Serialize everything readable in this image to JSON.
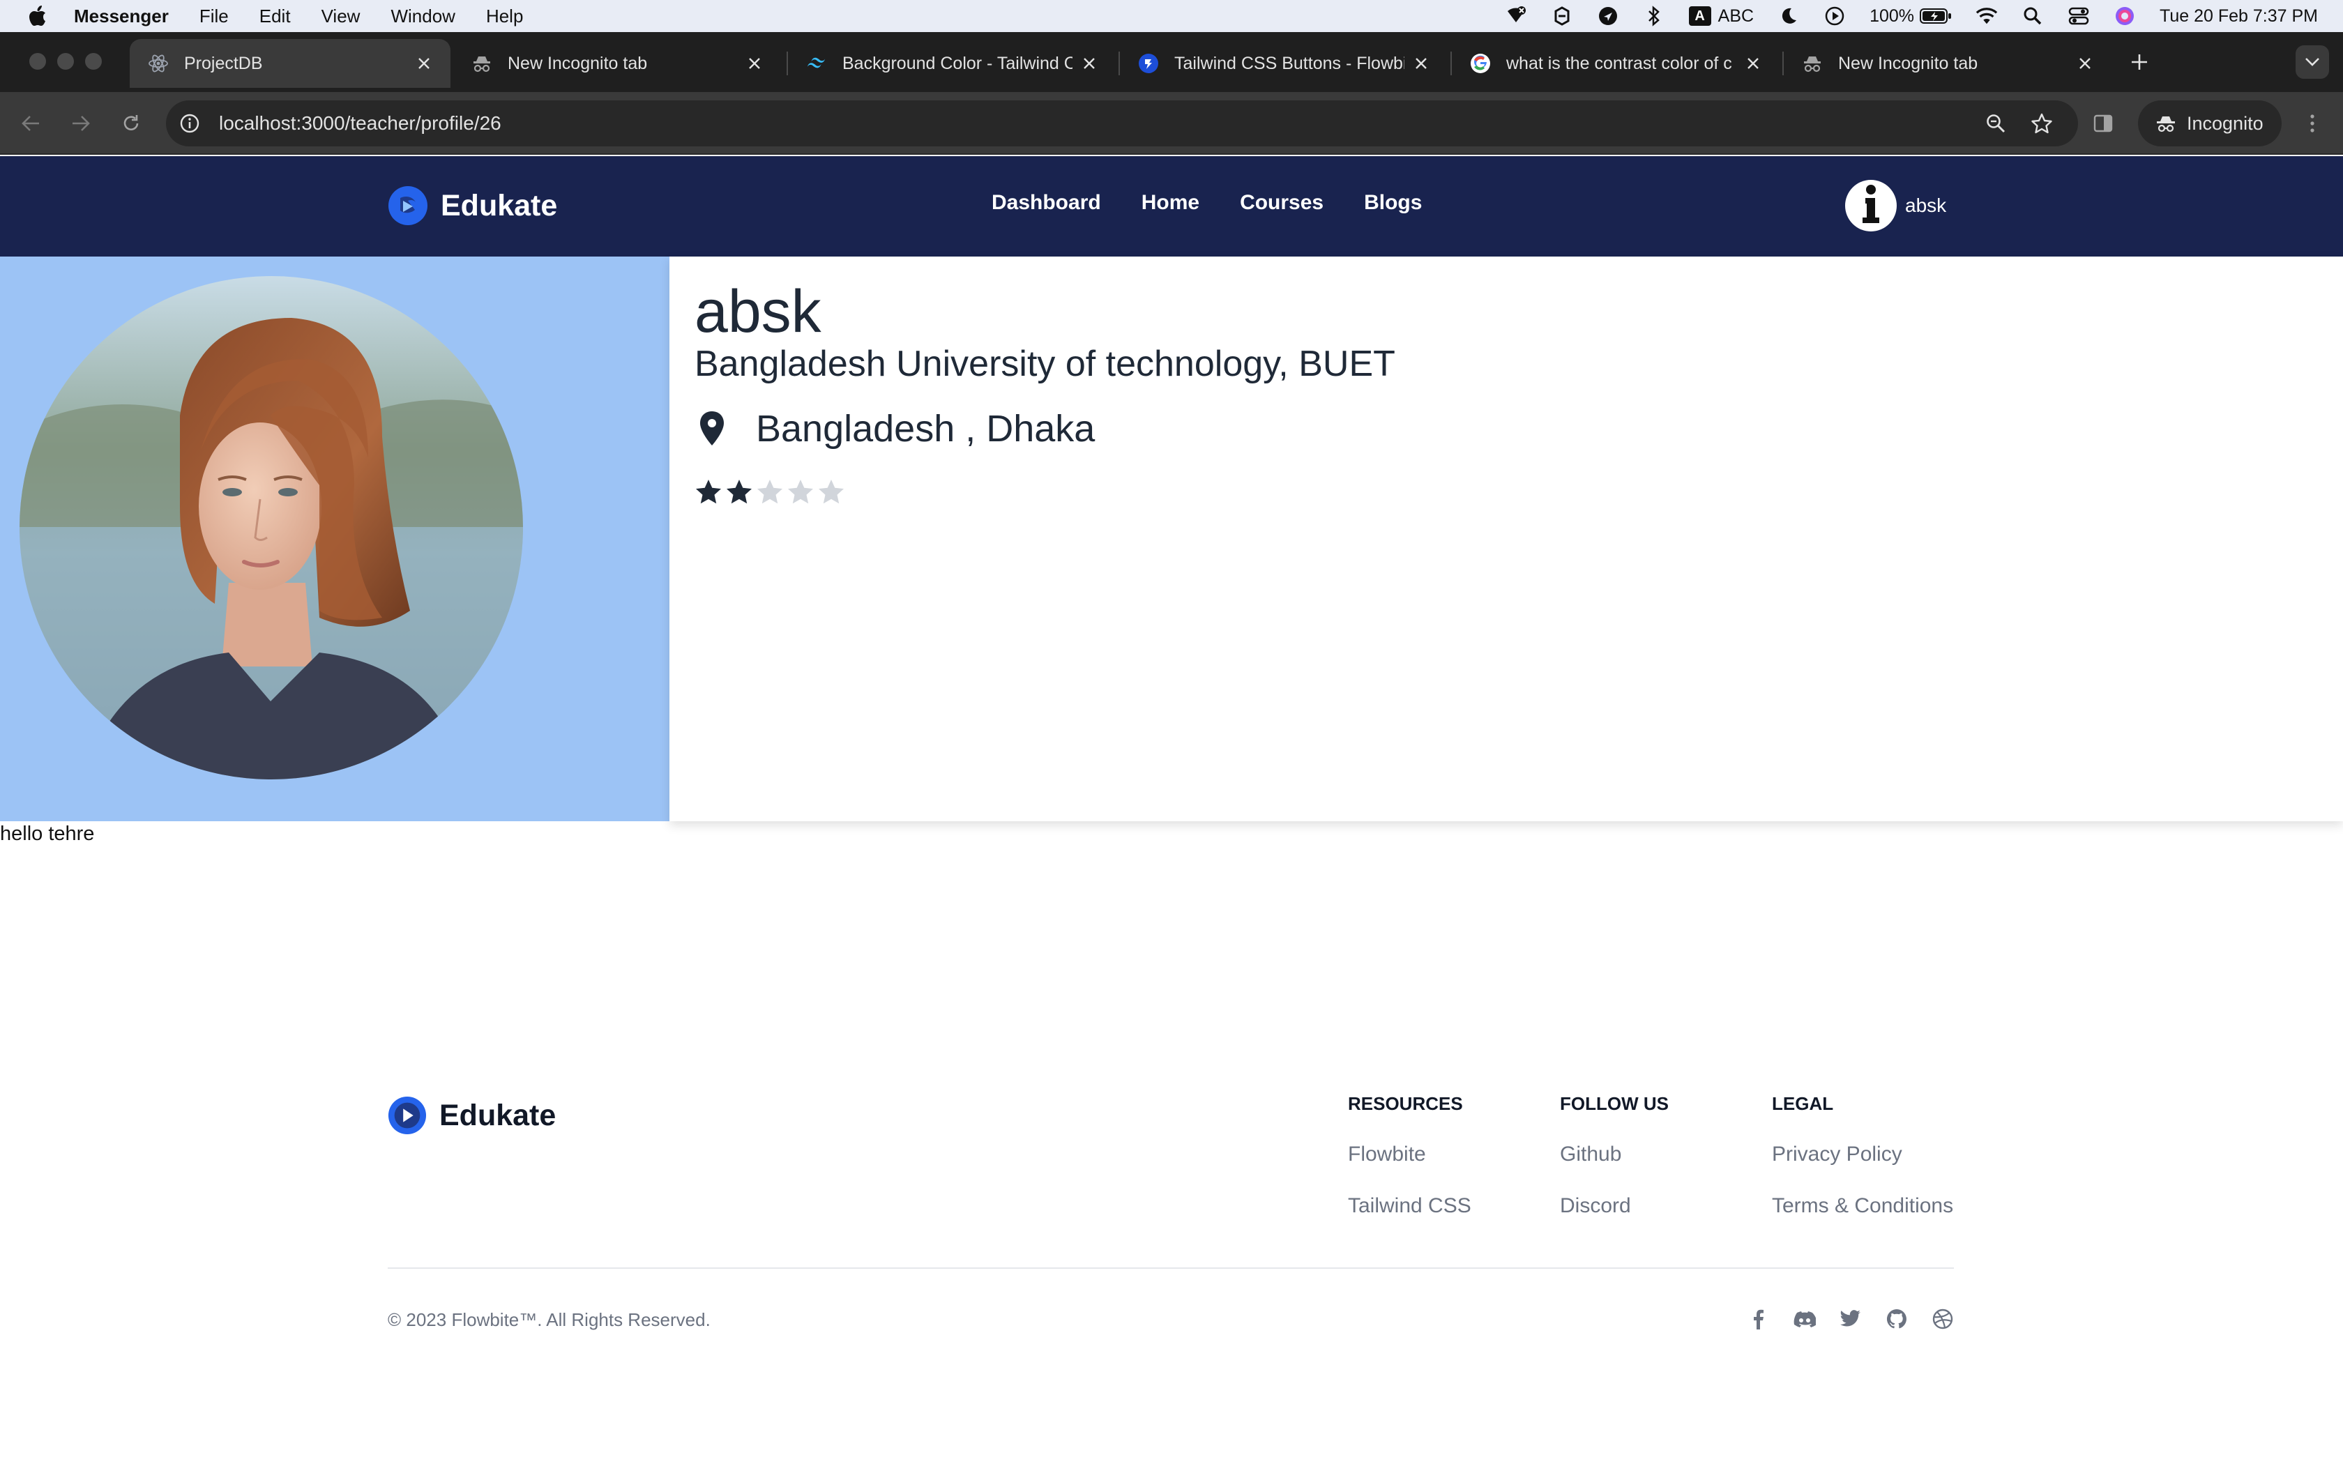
{
  "menubar": {
    "app_name": "Messenger",
    "menus": [
      "File",
      "Edit",
      "View",
      "Window",
      "Help"
    ],
    "input_source": "ABC",
    "battery": "100%",
    "datetime": "Tue 20 Feb  7:37 PM"
  },
  "tabs": [
    {
      "title": "ProjectDB",
      "icon": "react-icon",
      "active": true
    },
    {
      "title": "New Incognito tab",
      "icon": "incognito-icon",
      "active": false
    },
    {
      "title": "Background Color - Tailwind CSS",
      "icon": "tailwind-icon",
      "active": false
    },
    {
      "title": "Tailwind CSS Buttons - Flowbite",
      "icon": "flowbite-icon",
      "active": false
    },
    {
      "title": "what is the contrast color of c",
      "icon": "google-icon",
      "active": false
    },
    {
      "title": "New Incognito tab",
      "icon": "incognito-icon",
      "active": false
    }
  ],
  "toolbar": {
    "url": "localhost:3000/teacher/profile/26",
    "incognito_label": "Incognito"
  },
  "site_nav": {
    "brand": "Edukate",
    "links": [
      "Dashboard",
      "Home",
      "Courses",
      "Blogs"
    ],
    "username": "absk"
  },
  "profile": {
    "name": "absk",
    "institution": "Bangladesh University of technology, BUET",
    "location": "Bangladesh , Dhaka",
    "rating": 2,
    "rating_max": 5
  },
  "hello_text": "hello tehre",
  "footer": {
    "brand": "Edukate",
    "columns": [
      {
        "heading": "RESOURCES",
        "links": [
          "Flowbite",
          "Tailwind CSS"
        ]
      },
      {
        "heading": "FOLLOW US",
        "links": [
          "Github",
          "Discord"
        ]
      },
      {
        "heading": "LEGAL",
        "links": [
          "Privacy Policy",
          "Terms & Conditions"
        ]
      }
    ],
    "copyright": "© 2023 Flowbite™. All Rights Reserved.",
    "social_icons": [
      "facebook-icon",
      "discord-icon",
      "twitter-icon",
      "github-icon",
      "dribbble-icon"
    ]
  },
  "colors": {
    "navbar_bg": "#19234f",
    "photo_panel_bg": "#9cc3f5",
    "star_filled": "#1f2937",
    "star_empty": "#d1d5db",
    "brand_blue": "#2563eb"
  }
}
